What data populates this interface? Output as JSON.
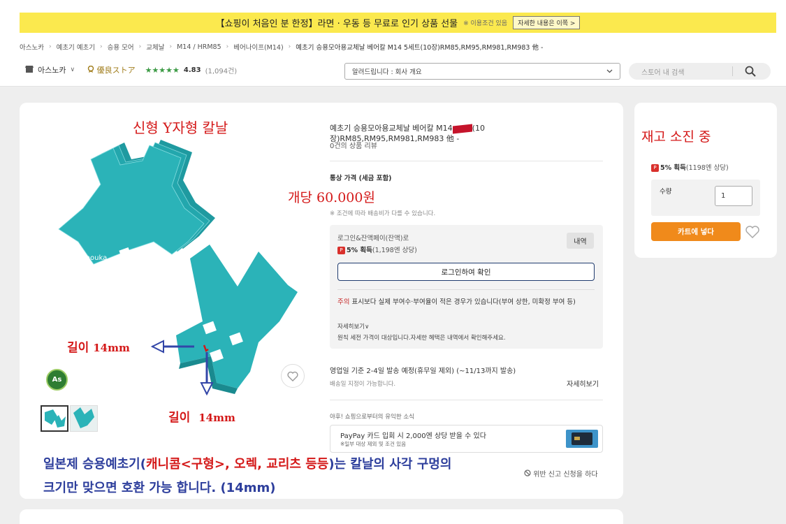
{
  "banner": {
    "text": "【쇼핑이 처음인 분 한정】라면 · 우동 등 무료로 인기 상품 선물",
    "note": "※ 이용조건 있음",
    "button": "자세한 내용은 이쪽 >"
  },
  "breadcrumb": [
    "아스노카",
    "예초기 예초기",
    "승용 모어",
    "교체날",
    "M14 / HRM85",
    "베어나이프(M14)",
    "예초기 승용모아용교체날 베어칼 M14 5세트(10장)RM85,RM95,RM981,RM983 他 -"
  ],
  "store": {
    "name": "아스노카",
    "badge": "優良ストア",
    "stars": "★★★★★",
    "rating": "4.83",
    "rating_count": "(1,094건)"
  },
  "notice": {
    "text": "알려드립니다 : 회사 개요"
  },
  "search": {
    "placeholder": "스토어 내 검색"
  },
  "overlay": {
    "headline": "신형 Y자형 칼날",
    "price": "개당 60.000원",
    "stock": "재고 소진 중",
    "length_label_1": "길이",
    "length_value_1": "14mm",
    "length_label_2": "길이",
    "length_value_2": "14mm",
    "caption_line1_a": "일본제 승용예초기(",
    "caption_line1_b": "캐니콤<구형>, 오렉, 교리츠 등등",
    "caption_line1_c": ")는 칼날의 사각 구멍의",
    "caption_line2": "크기만 맞으면 호환 가능 합니다. (14mm)",
    "watermark": "asunouka",
    "logo": "As"
  },
  "product": {
    "title_a": "예초기 승용모아용교체날 베어칼 M14",
    "title_b": "(10장)RM85,RM95,RM981,RM983 他 -",
    "reviews": "0건의 상품 리뷰",
    "price_label": "통상 가격 (세금 포함)",
    "shipping_note": "※ 조건에 따라 배송비가 다를 수 있습니다."
  },
  "coupon": {
    "title": "로그인&잔액페이(잔액)로",
    "reward": "5% 획득",
    "reward_detail": "(1,198엔 상당)",
    "history_button": "내역",
    "login_button": "로그인하여 확인",
    "caution_label": "주의",
    "caution_text": "표시보다 실제 부여수·부여율이 적은 경우가 있습니다(부여 상한, 미확정 부여 등)",
    "details_link": "자세히보기",
    "footnote": "원칙 세전 가격이 대상입니다.자세한 혜택은 내역에서 확인해주세요."
  },
  "shipping": {
    "schedule": "영업일 기준 2-4일 발송 예정(휴무일 제외) (~11/13까지 발송)",
    "date_note": "배송일 지정이 가능합니다.",
    "details_link": "자세히보기"
  },
  "promo": {
    "heading": "야후! 쇼핑으로부터의 유익한 소식",
    "title": "PayPay 카드 입회 시 2,000엔 상당 받을 수 있다",
    "note": "※일부 대상 제외 및 조건 있음"
  },
  "report": {
    "link": "위반 신고 신청을 하다"
  },
  "side": {
    "reward": "5% 획득",
    "reward_detail": "(1198엔 상당)",
    "qty_label": "수량",
    "qty_value": "1",
    "cart_button": "카트에 넣다"
  },
  "colors": {
    "banner": "#fbe94e",
    "accent_red": "#d41818",
    "caption_blue": "#2d3e9c",
    "cart_orange": "#f08a1b",
    "blade_teal": "#2bb3b8"
  }
}
